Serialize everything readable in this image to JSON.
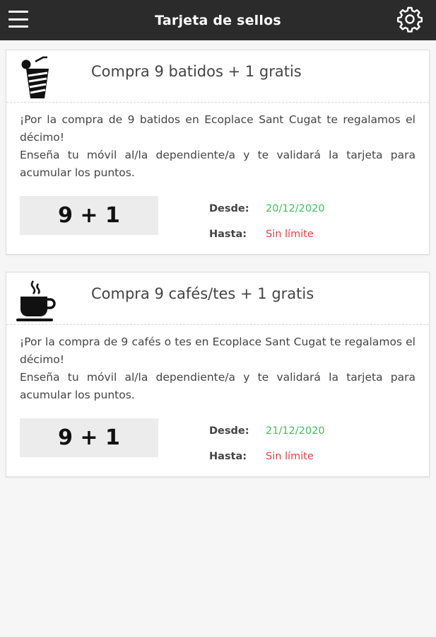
{
  "appbar": {
    "title": "Tarjeta de sellos",
    "menu_icon": "hamburger-menu-icon",
    "settings_icon": "gear-icon"
  },
  "cards": [
    {
      "icon": "smoothie-cup-icon",
      "title": "Compra 9 batidos + 1 gratis",
      "description_line1": "¡Por la compra de 9 batidos en Ecoplace Sant Cugat te regalamos el décimo!",
      "description_line2": "Enseña tu móvil al/la dependiente/a y te validará la tarjeta para acumular los puntos.",
      "ratio": "9 + 1",
      "from_label": "Desde:",
      "from_value": "20/12/2020",
      "until_label": "Hasta:",
      "until_value": "Sin límite"
    },
    {
      "icon": "coffee-cup-icon",
      "title": "Compra 9 cafés/tes + 1 gratis",
      "description_line1": "¡Por la compra de 9 cafés o tes en Ecoplace Sant Cugat te regalamos el décimo!",
      "description_line2": "Enseña tu móvil al/la dependiente/a y te validará la tarjeta para acumular los puntos.",
      "ratio": "9 + 1",
      "from_label": "Desde:",
      "from_value": "21/12/2020",
      "until_label": "Hasta:",
      "until_value": "Sin límite"
    }
  ],
  "colors": {
    "appbar": "#2b2b2b",
    "date_from": "#3fbf5f",
    "date_until": "#e2404a"
  }
}
